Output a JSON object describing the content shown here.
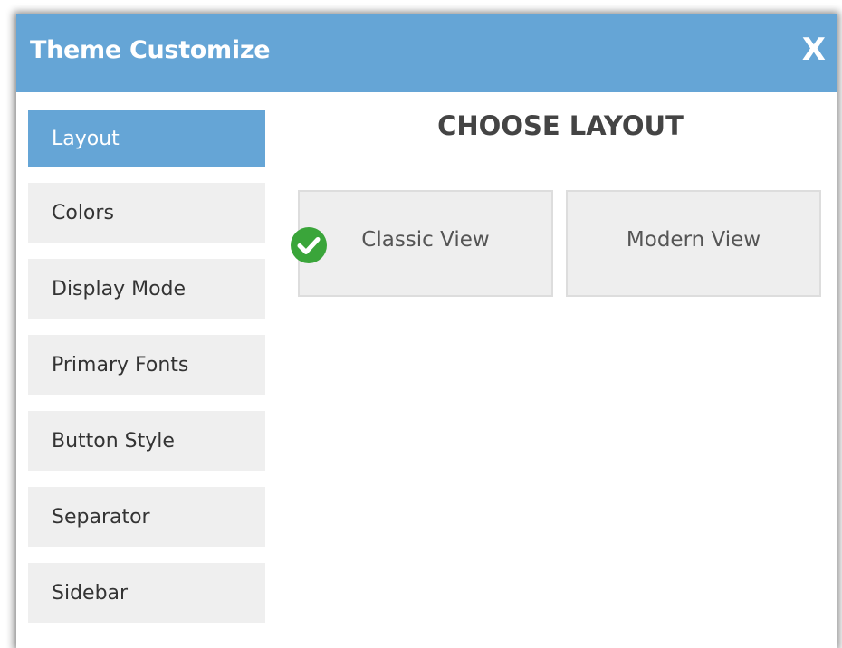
{
  "header": {
    "title": "Theme Customize",
    "close_label": "X"
  },
  "sidebar": {
    "items": [
      {
        "label": "Layout",
        "active": true
      },
      {
        "label": "Colors"
      },
      {
        "label": "Display Mode"
      },
      {
        "label": "Primary Fonts"
      },
      {
        "label": "Button Style"
      },
      {
        "label": "Separator"
      },
      {
        "label": "Sidebar"
      }
    ]
  },
  "main": {
    "title": "CHOOSE LAYOUT",
    "options": [
      {
        "label": "Classic View",
        "selected": true
      },
      {
        "label": "Modern View"
      }
    ]
  },
  "colors": {
    "accent": "#65a5d6",
    "check": "#3aa53a",
    "item_bg": "#efefef"
  },
  "icons": {
    "close": "close-icon",
    "selected": "check-circle-icon"
  }
}
